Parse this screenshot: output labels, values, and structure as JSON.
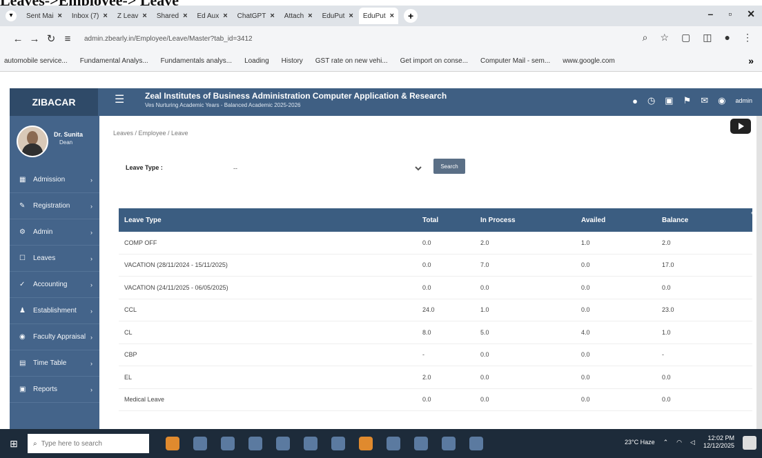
{
  "doc_heading": "Leaves->Employee-> Leave",
  "browser": {
    "tabs": [
      {
        "label": "Sent Mai",
        "active": false
      },
      {
        "label": "Inbox (7)",
        "active": false
      },
      {
        "label": "Z Leav",
        "active": false
      },
      {
        "label": "Shared",
        "active": false
      },
      {
        "label": "Ed Aux",
        "active": false
      },
      {
        "label": "ChatGPT",
        "active": false
      },
      {
        "label": "Attach",
        "active": false
      },
      {
        "label": "EduPut",
        "active": false
      },
      {
        "label": "EduPut",
        "active": true
      }
    ],
    "new_tab": "+",
    "url": "admin.zbearly.in/Employee/Leave/Master?tab_id=3412",
    "bookmarks": [
      "automobile service...",
      "Fundamental Analys...",
      "Fundamentals analys...",
      "Loading",
      "History",
      "GST rate on new vehi...",
      "Get import on conse...",
      "Computer Mail - sem...",
      "www.google.com"
    ]
  },
  "app": {
    "logo": "ZIBACAR",
    "institute_title": "Zeal Institutes of Business Administration Computer Application & Research",
    "institute_sub": "Ves Nurturing Academic Years - Balanced Academic 2025-2026",
    "user_label": "admin",
    "profile": {
      "name": "Dr. Sunita",
      "role": "Dean"
    },
    "menu": [
      {
        "label": "Admission",
        "icon": "▦"
      },
      {
        "label": "Registration",
        "icon": "✎"
      },
      {
        "label": "Admin",
        "icon": "⚙"
      },
      {
        "label": "Leaves",
        "icon": "☐"
      },
      {
        "label": "Accounting",
        "icon": "✓"
      },
      {
        "label": "Establishment",
        "icon": "♟"
      },
      {
        "label": "Faculty Appraisal",
        "icon": "◉"
      },
      {
        "label": "Time Table",
        "icon": "▤"
      },
      {
        "label": "Reports",
        "icon": "▣"
      }
    ]
  },
  "content": {
    "breadcrumb": "Leaves / Employee / Leave",
    "leave_type_label": "Leave Type :",
    "leave_type_value": "--",
    "search_label": "Search",
    "table": {
      "headers": [
        "Leave Type",
        "Total",
        "In Process",
        "Availed",
        "Balance"
      ],
      "rows": [
        [
          "COMP OFF",
          "0.0",
          "2.0",
          "1.0",
          "2.0"
        ],
        [
          "VACATION (28/11/2024 - 15/11/2025)",
          "0.0",
          "7.0",
          "0.0",
          "17.0"
        ],
        [
          "VACATION (24/11/2025 - 06/05/2025)",
          "0.0",
          "0.0",
          "0.0",
          "0.0"
        ],
        [
          "CCL",
          "24.0",
          "1.0",
          "0.0",
          "23.0"
        ],
        [
          "CL",
          "8.0",
          "5.0",
          "4.0",
          "1.0"
        ],
        [
          "CBP",
          "-",
          "0.0",
          "0.0",
          "-"
        ],
        [
          "EL",
          "2.0",
          "0.0",
          "0.0",
          "0.0"
        ],
        [
          "Medical Leave",
          "0.0",
          "0.0",
          "0.0",
          "0.0"
        ]
      ]
    }
  },
  "taskbar": {
    "search_placeholder": "Type here to search",
    "weather": "23°C Haze",
    "time": "12:02 PM",
    "date": "12/12/2025"
  }
}
